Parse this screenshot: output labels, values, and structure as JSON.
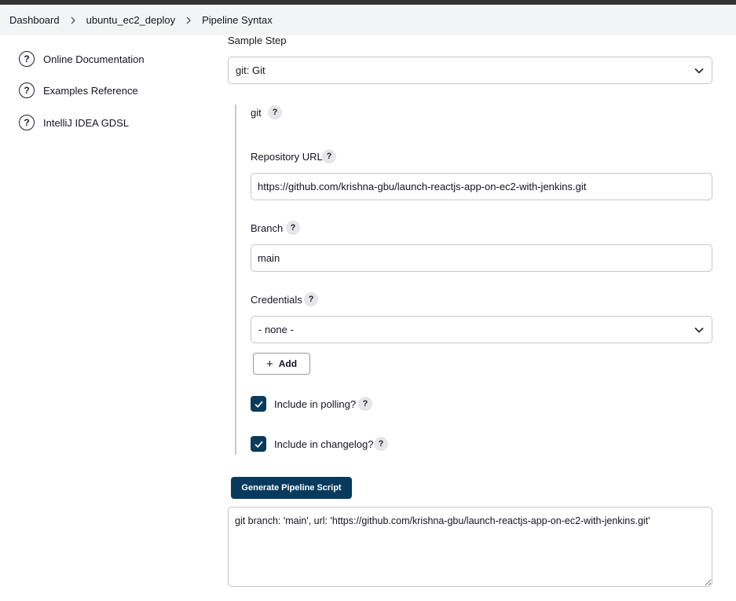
{
  "breadcrumb": {
    "items": [
      "Dashboard",
      "ubuntu_ec2_deploy",
      "Pipeline Syntax"
    ]
  },
  "sidebar": {
    "items": [
      {
        "label": "Online Documentation",
        "icon": "question-circle-icon"
      },
      {
        "label": "Examples Reference",
        "icon": "question-circle-icon"
      },
      {
        "label": "IntelliJ IDEA GDSL",
        "icon": "question-circle-icon"
      }
    ]
  },
  "form": {
    "sample_step_label": "Sample Step",
    "sample_step_value": "git: Git",
    "step_name": "git",
    "help_glyph": "?",
    "repo_url_label": "Repository URL",
    "repo_url_value": "https://github.com/krishna-gbu/launch-reactjs-app-on-ec2-with-jenkins.git",
    "branch_label": "Branch",
    "branch_value": "main",
    "credentials_label": "Credentials",
    "credentials_value": "- none -",
    "add_button_label": "Add",
    "add_button_plus": "+",
    "polling_label": "Include in polling?",
    "polling_checked": true,
    "changelog_label": "Include in changelog?",
    "changelog_checked": true
  },
  "generate": {
    "button_label": "Generate Pipeline Script",
    "output": "git branch: 'main', url: 'https://github.com/krishna-gbu/launch-reactjs-app-on-ec2-with-jenkins.git'"
  },
  "colors": {
    "primary_button": "#083a5e",
    "checkbox": "#0b3b5b",
    "breadcrumb_bg": "#f3f4f6"
  }
}
